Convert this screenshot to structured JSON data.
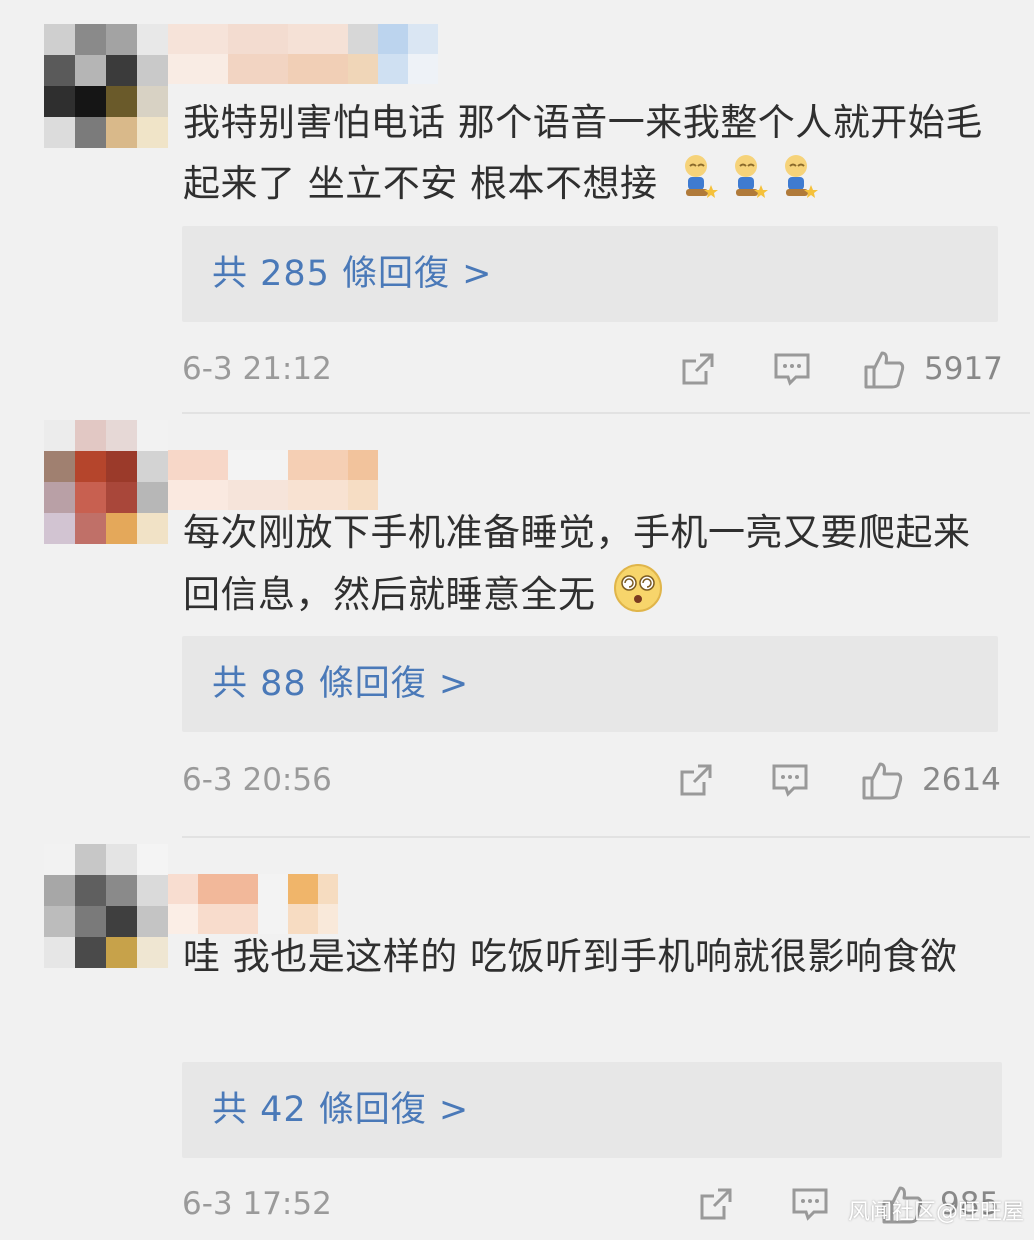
{
  "comments": [
    {
      "text": "我特别害怕电话 那个语音一来我整个人就开始毛起来了 坐立不安 根本不想接",
      "emoji": "doge-emoji",
      "replies_label": "共 285 條回復 >",
      "time": "6-3 21:12",
      "likes": "5917"
    },
    {
      "text": "每次刚放下手机准备睡觉，手机一亮又要爬起来回信息，然后就睡意全无",
      "emoji": "dizzy-face-emoji",
      "replies_label": "共 88 條回復 >",
      "time": "6-3 20:56",
      "likes": "2614"
    },
    {
      "text": "哇 我也是这样的 吃饭听到手机响就很影响食欲",
      "replies_label": "共 42 條回復 >",
      "time": "6-3 17:52",
      "likes": "985"
    }
  ],
  "watermark": "风闻社区@旺旺屋",
  "icons": {
    "share": "share-icon",
    "comment": "comment-icon",
    "like": "thumbs-up-icon"
  },
  "colors": {
    "link": "#4a79b8",
    "reply_box": "#e7e7e7",
    "background": "#f1f1f1"
  }
}
